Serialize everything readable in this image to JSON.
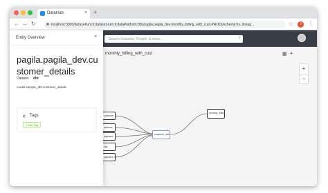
{
  "browser": {
    "tab_title": "DataHub",
    "tab_close": "×",
    "new_tab": "+",
    "url": "localhost:3000/dataset/urn:li:dataset:(urn:li:dataPlatform:dbt,pagila.pagila_dev.monthly_billing_with_cust,PROD)/schema?is_lineag...",
    "profile_initial": "J"
  },
  "header": {
    "search_placeholder": "Search Datasets, People, & more..."
  },
  "lineage": {
    "title": "monthly_billing_with_cust",
    "zoom_in": "+",
    "zoom_out": "−",
    "nodes": [
      {
        "label": "customer"
      },
      {
        "label": "address"
      },
      {
        "label": "payment"
      },
      {
        "label": "city"
      },
      {
        "label": "payment_by_cust"
      },
      {
        "label": "customer_details"
      },
      {
        "label": "monthly_billing..."
      }
    ]
  },
  "panel": {
    "title": "Entity Overview",
    "close": "×",
    "entity_name": "pagila.pagila_dev.customer_details",
    "platform_label": "Dataset",
    "platform_value": "dbt",
    "urn": "model.sample_dbt.customer_details",
    "tags_label": "Tags",
    "add_tag": "+ Add Tag"
  }
}
